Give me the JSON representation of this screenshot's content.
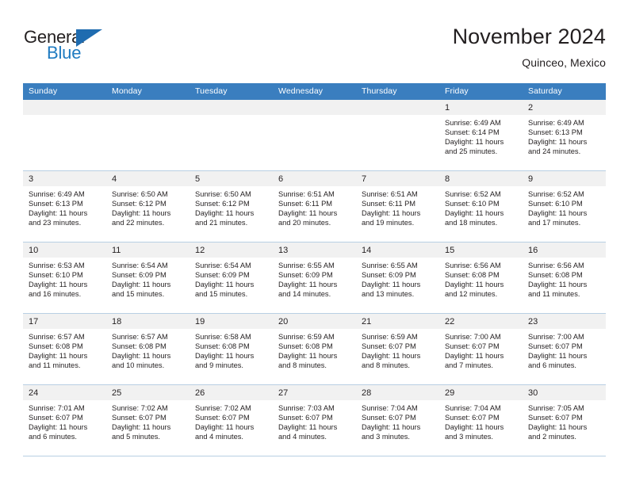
{
  "logo": {
    "word1": "General",
    "word2": "Blue",
    "triangle_color": "#1f6cb0",
    "blue_color": "#1f7bc1",
    "icon": "general-blue-logo"
  },
  "header": {
    "title": "November 2024",
    "subtitle": "Quinceo, Mexico"
  },
  "theme": {
    "header_bg": "#3a7ebf",
    "date_bar_bg": "#f1f1f1",
    "grid_line": "#b8cfe3",
    "text": "#231f20"
  },
  "weekdays": [
    "Sunday",
    "Monday",
    "Tuesday",
    "Wednesday",
    "Thursday",
    "Friday",
    "Saturday"
  ],
  "weeks": [
    [
      {
        "day": "",
        "sunrise": "",
        "sunset": "",
        "daylight1": "",
        "daylight2": ""
      },
      {
        "day": "",
        "sunrise": "",
        "sunset": "",
        "daylight1": "",
        "daylight2": ""
      },
      {
        "day": "",
        "sunrise": "",
        "sunset": "",
        "daylight1": "",
        "daylight2": ""
      },
      {
        "day": "",
        "sunrise": "",
        "sunset": "",
        "daylight1": "",
        "daylight2": ""
      },
      {
        "day": "",
        "sunrise": "",
        "sunset": "",
        "daylight1": "",
        "daylight2": ""
      },
      {
        "day": "1",
        "sunrise": "Sunrise: 6:49 AM",
        "sunset": "Sunset: 6:14 PM",
        "daylight1": "Daylight: 11 hours",
        "daylight2": "and 25 minutes."
      },
      {
        "day": "2",
        "sunrise": "Sunrise: 6:49 AM",
        "sunset": "Sunset: 6:13 PM",
        "daylight1": "Daylight: 11 hours",
        "daylight2": "and 24 minutes."
      }
    ],
    [
      {
        "day": "3",
        "sunrise": "Sunrise: 6:49 AM",
        "sunset": "Sunset: 6:13 PM",
        "daylight1": "Daylight: 11 hours",
        "daylight2": "and 23 minutes."
      },
      {
        "day": "4",
        "sunrise": "Sunrise: 6:50 AM",
        "sunset": "Sunset: 6:12 PM",
        "daylight1": "Daylight: 11 hours",
        "daylight2": "and 22 minutes."
      },
      {
        "day": "5",
        "sunrise": "Sunrise: 6:50 AM",
        "sunset": "Sunset: 6:12 PM",
        "daylight1": "Daylight: 11 hours",
        "daylight2": "and 21 minutes."
      },
      {
        "day": "6",
        "sunrise": "Sunrise: 6:51 AM",
        "sunset": "Sunset: 6:11 PM",
        "daylight1": "Daylight: 11 hours",
        "daylight2": "and 20 minutes."
      },
      {
        "day": "7",
        "sunrise": "Sunrise: 6:51 AM",
        "sunset": "Sunset: 6:11 PM",
        "daylight1": "Daylight: 11 hours",
        "daylight2": "and 19 minutes."
      },
      {
        "day": "8",
        "sunrise": "Sunrise: 6:52 AM",
        "sunset": "Sunset: 6:10 PM",
        "daylight1": "Daylight: 11 hours",
        "daylight2": "and 18 minutes."
      },
      {
        "day": "9",
        "sunrise": "Sunrise: 6:52 AM",
        "sunset": "Sunset: 6:10 PM",
        "daylight1": "Daylight: 11 hours",
        "daylight2": "and 17 minutes."
      }
    ],
    [
      {
        "day": "10",
        "sunrise": "Sunrise: 6:53 AM",
        "sunset": "Sunset: 6:10 PM",
        "daylight1": "Daylight: 11 hours",
        "daylight2": "and 16 minutes."
      },
      {
        "day": "11",
        "sunrise": "Sunrise: 6:54 AM",
        "sunset": "Sunset: 6:09 PM",
        "daylight1": "Daylight: 11 hours",
        "daylight2": "and 15 minutes."
      },
      {
        "day": "12",
        "sunrise": "Sunrise: 6:54 AM",
        "sunset": "Sunset: 6:09 PM",
        "daylight1": "Daylight: 11 hours",
        "daylight2": "and 15 minutes."
      },
      {
        "day": "13",
        "sunrise": "Sunrise: 6:55 AM",
        "sunset": "Sunset: 6:09 PM",
        "daylight1": "Daylight: 11 hours",
        "daylight2": "and 14 minutes."
      },
      {
        "day": "14",
        "sunrise": "Sunrise: 6:55 AM",
        "sunset": "Sunset: 6:09 PM",
        "daylight1": "Daylight: 11 hours",
        "daylight2": "and 13 minutes."
      },
      {
        "day": "15",
        "sunrise": "Sunrise: 6:56 AM",
        "sunset": "Sunset: 6:08 PM",
        "daylight1": "Daylight: 11 hours",
        "daylight2": "and 12 minutes."
      },
      {
        "day": "16",
        "sunrise": "Sunrise: 6:56 AM",
        "sunset": "Sunset: 6:08 PM",
        "daylight1": "Daylight: 11 hours",
        "daylight2": "and 11 minutes."
      }
    ],
    [
      {
        "day": "17",
        "sunrise": "Sunrise: 6:57 AM",
        "sunset": "Sunset: 6:08 PM",
        "daylight1": "Daylight: 11 hours",
        "daylight2": "and 11 minutes."
      },
      {
        "day": "18",
        "sunrise": "Sunrise: 6:57 AM",
        "sunset": "Sunset: 6:08 PM",
        "daylight1": "Daylight: 11 hours",
        "daylight2": "and 10 minutes."
      },
      {
        "day": "19",
        "sunrise": "Sunrise: 6:58 AM",
        "sunset": "Sunset: 6:08 PM",
        "daylight1": "Daylight: 11 hours",
        "daylight2": "and 9 minutes."
      },
      {
        "day": "20",
        "sunrise": "Sunrise: 6:59 AM",
        "sunset": "Sunset: 6:08 PM",
        "daylight1": "Daylight: 11 hours",
        "daylight2": "and 8 minutes."
      },
      {
        "day": "21",
        "sunrise": "Sunrise: 6:59 AM",
        "sunset": "Sunset: 6:07 PM",
        "daylight1": "Daylight: 11 hours",
        "daylight2": "and 8 minutes."
      },
      {
        "day": "22",
        "sunrise": "Sunrise: 7:00 AM",
        "sunset": "Sunset: 6:07 PM",
        "daylight1": "Daylight: 11 hours",
        "daylight2": "and 7 minutes."
      },
      {
        "day": "23",
        "sunrise": "Sunrise: 7:00 AM",
        "sunset": "Sunset: 6:07 PM",
        "daylight1": "Daylight: 11 hours",
        "daylight2": "and 6 minutes."
      }
    ],
    [
      {
        "day": "24",
        "sunrise": "Sunrise: 7:01 AM",
        "sunset": "Sunset: 6:07 PM",
        "daylight1": "Daylight: 11 hours",
        "daylight2": "and 6 minutes."
      },
      {
        "day": "25",
        "sunrise": "Sunrise: 7:02 AM",
        "sunset": "Sunset: 6:07 PM",
        "daylight1": "Daylight: 11 hours",
        "daylight2": "and 5 minutes."
      },
      {
        "day": "26",
        "sunrise": "Sunrise: 7:02 AM",
        "sunset": "Sunset: 6:07 PM",
        "daylight1": "Daylight: 11 hours",
        "daylight2": "and 4 minutes."
      },
      {
        "day": "27",
        "sunrise": "Sunrise: 7:03 AM",
        "sunset": "Sunset: 6:07 PM",
        "daylight1": "Daylight: 11 hours",
        "daylight2": "and 4 minutes."
      },
      {
        "day": "28",
        "sunrise": "Sunrise: 7:04 AM",
        "sunset": "Sunset: 6:07 PM",
        "daylight1": "Daylight: 11 hours",
        "daylight2": "and 3 minutes."
      },
      {
        "day": "29",
        "sunrise": "Sunrise: 7:04 AM",
        "sunset": "Sunset: 6:07 PM",
        "daylight1": "Daylight: 11 hours",
        "daylight2": "and 3 minutes."
      },
      {
        "day": "30",
        "sunrise": "Sunrise: 7:05 AM",
        "sunset": "Sunset: 6:07 PM",
        "daylight1": "Daylight: 11 hours",
        "daylight2": "and 2 minutes."
      }
    ]
  ]
}
